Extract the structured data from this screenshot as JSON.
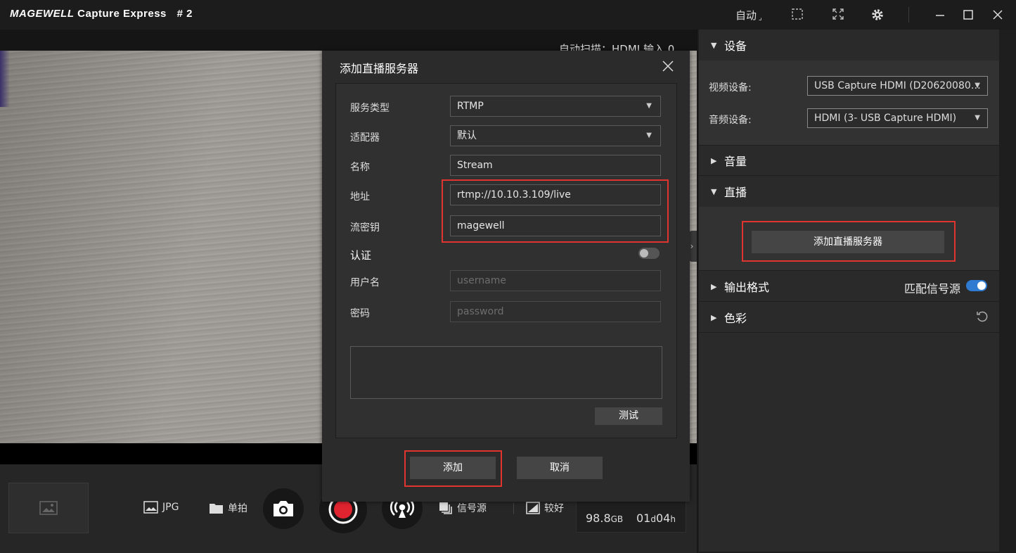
{
  "titlebar": {
    "brand": "MAGEWELL",
    "app_name": "Capture Express",
    "instance": "# 2",
    "auto_label": "自动",
    "icons": [
      "crop-icon",
      "fullscreen-icon",
      "gear-icon",
      "minimize-icon",
      "maximize-icon",
      "close-icon"
    ]
  },
  "preview": {
    "scan_status": "自动扫描：HDMI 输入 0"
  },
  "toolbar": {
    "format_label": "JPG",
    "shot_label": "单拍",
    "source_label": "信号源",
    "quality_label": "较好",
    "disk_free": "98.8",
    "disk_unit": "GB",
    "duration_days": "01",
    "duration_d_unit": "d",
    "duration_hours": "04",
    "duration_h_unit": "h"
  },
  "right_panel": {
    "device_section": "设备",
    "video_device_label": "视频设备:",
    "video_device_value": "USB Capture HDMI (D20620080…",
    "audio_device_label": "音频设备:",
    "audio_device_value": "HDMI (3- USB Capture HDMI)",
    "volume_section": "音量",
    "live_section": "直播",
    "add_server_button": "添加直播服务器",
    "output_section": "输出格式",
    "match_source_label": "匹配信号源",
    "match_source_on": true,
    "color_section": "色彩"
  },
  "dialog": {
    "title": "添加直播服务器",
    "service_type_label": "服务类型",
    "service_type_value": "RTMP",
    "adapter_label": "适配器",
    "adapter_value": "默认",
    "name_label": "名称",
    "name_value": "Stream",
    "address_label": "地址",
    "address_value": "rtmp://10.10.3.109/live",
    "stream_key_label": "流密钥",
    "stream_key_value": "magewell",
    "auth_label": "认证",
    "auth_on": false,
    "username_label": "用户名",
    "username_placeholder": "username",
    "password_label": "密码",
    "password_placeholder": "password",
    "test_button": "测试",
    "add_button": "添加",
    "cancel_button": "取消"
  },
  "colors": {
    "highlight": "#e0342e",
    "toggle_on": "#2f7bd1",
    "record": "#e0242f"
  }
}
